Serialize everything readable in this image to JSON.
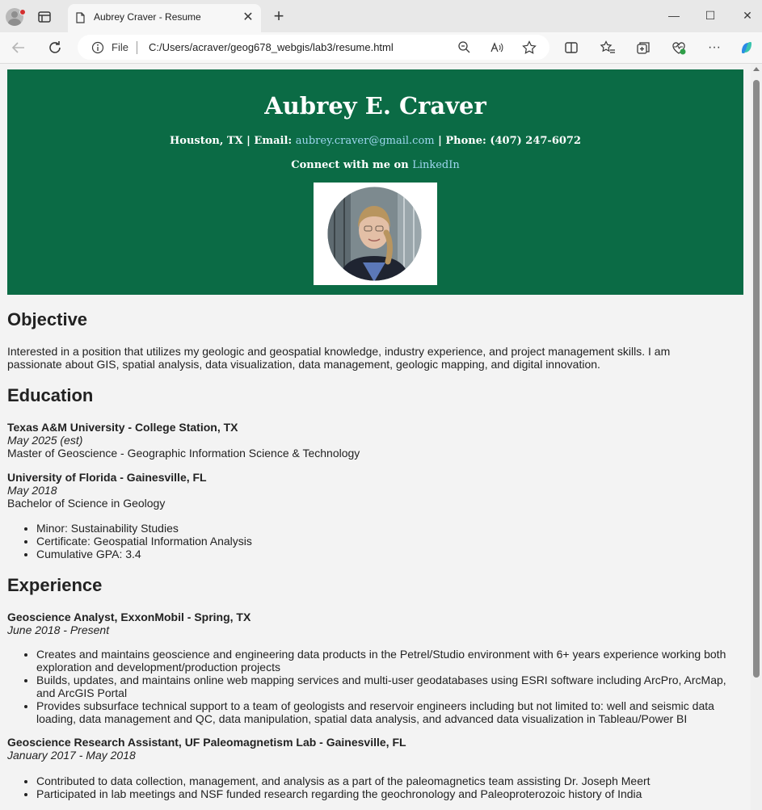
{
  "browser": {
    "tab_title": "Aubrey Craver - Resume",
    "url_scheme_label": "File",
    "url_path": "C:/Users/acraver/geog678_webgis/lab3/resume.html",
    "close_tab_glyph": "✕",
    "new_tab_glyph": "+",
    "minimize_glyph": "—",
    "maximize_glyph": "☐",
    "close_window_glyph": "✕",
    "more_glyph": "···"
  },
  "header": {
    "name": "Aubrey E. Craver",
    "location": "Houston, TX | Email: ",
    "email": "aubrey.craver@gmail.com",
    "phone": " | Phone: (407) 247-6072",
    "connect_prefix": "Connect with me on ",
    "linkedin": "LinkedIn",
    "colors": {
      "banner": "#0b6b45",
      "link": "#9fd6f0"
    }
  },
  "objective": {
    "heading": "Objective",
    "line1": "Interested in a position that utilizes my geologic and geospatial knowledge, industry experience, and project management skills. I am",
    "line2": "passionate about GIS, spatial analysis, data visualization, data management, geologic mapping, and digital innovation."
  },
  "education": {
    "heading": "Education",
    "schools": [
      {
        "name": "Texas A&M University - College Station, TX",
        "date": "May 2025 (est)",
        "degree": "Master of Geoscience - Geographic Information Science & Technology"
      },
      {
        "name": "University of Florida - Gainesville, FL",
        "date": "May 2018",
        "degree": "Bachelor of Science in Geology",
        "details": [
          "Minor: Sustainability Studies",
          "Certificate: Geospatial Information Analysis",
          "Cumulative GPA: 3.4"
        ]
      }
    ]
  },
  "experience": {
    "heading": "Experience",
    "jobs": [
      {
        "title": "Geoscience Analyst, ExxonMobil - Spring, TX",
        "date": "June 2018 - Present",
        "bullets": [
          "Creates and maintains geoscience and engineering data products in the Petrel/Studio environment with 6+ years experience working both exploration and development/production projects",
          "Builds, updates, and maintains online web mapping services and multi-user geodatabases using ESRI software including ArcPro, ArcMap, and ArcGIS Portal",
          "Provides subsurface technical support to a team of geologists and reservoir engineers including but not limited to: well and seismic data loading, data management and QC, data manipulation, spatial data analysis, and advanced data visualization in Tableau/Power BI"
        ]
      },
      {
        "title": "Geoscience Research Assistant, UF Paleomagnetism Lab - Gainesville, FL",
        "date": "January 2017 - May 2018",
        "bullets": [
          "Contributed to data collection, management, and analysis as a part of the paleomagnetics team assisting Dr. Joseph Meert",
          "Participated in lab meetings and NSF funded research regarding the geochronology and Paleoproterozoic history of India"
        ]
      }
    ]
  }
}
